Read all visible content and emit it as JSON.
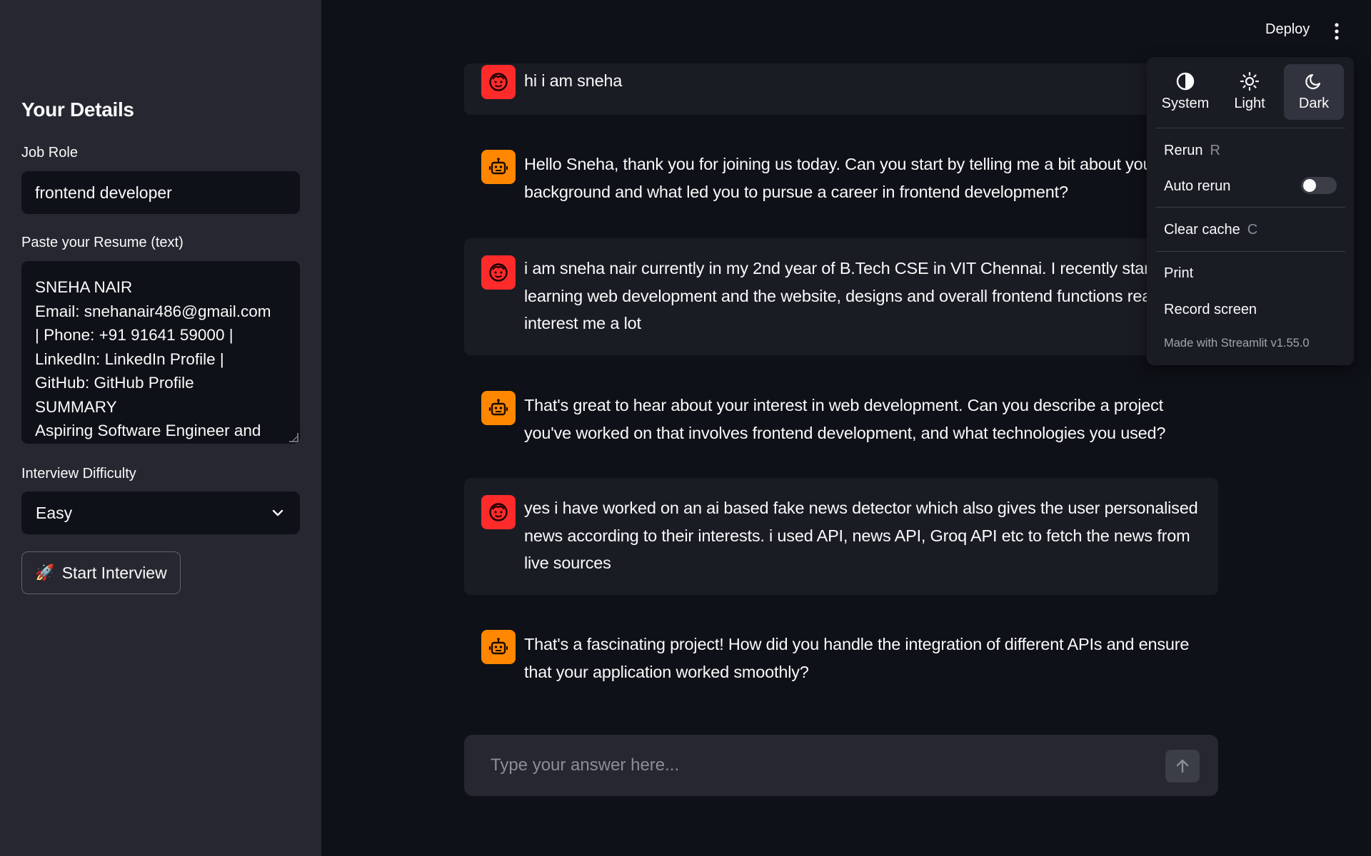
{
  "sidebar": {
    "title": "Your Details",
    "job_role": {
      "label": "Job Role",
      "value": "frontend developer"
    },
    "resume": {
      "label": "Paste your Resume (text)",
      "lines": [
        "SNEHA NAIR",
        "Email: snehanair486@gmail.com",
        "| Phone: +91 91641 59000 |",
        "LinkedIn: LinkedIn Profile |",
        "GitHub: GitHub Profile",
        "SUMMARY",
        "Aspiring Software Engineer and"
      ]
    },
    "difficulty": {
      "label": "Interview Difficulty",
      "value": "Easy"
    },
    "start_button": "Start Interview"
  },
  "toolbar": {
    "deploy_label": "Deploy"
  },
  "chat": {
    "messages": [
      {
        "role": "user",
        "text": "hi i am sneha"
      },
      {
        "role": "assistant",
        "text": "Hello Sneha, thank you for joining us today. Can you start by telling me a bit about your background and what led you to pursue a career in frontend development?"
      },
      {
        "role": "user",
        "text": "i am sneha nair currently in my 2nd year of B.Tech CSE in VIT Chennai. I recently started learning web development and the website, designs and overall frontend functions really interest me a lot"
      },
      {
        "role": "assistant",
        "text": "That's great to hear about your interest in web development. Can you describe a project you've worked on that involves frontend development, and what technologies you used?"
      },
      {
        "role": "user",
        "text": "yes i have worked on an ai based fake news detector which also gives the user personalised news according to their interests. i used API, news API, Groq API etc to fetch the news from live sources"
      },
      {
        "role": "assistant",
        "text": "That's a fascinating project! How did you handle the integration of different APIs and ensure that your application worked smoothly?"
      }
    ],
    "input_placeholder": "Type your answer here..."
  },
  "menu": {
    "themes": [
      {
        "label": "System",
        "icon": "contrast-icon"
      },
      {
        "label": "Light",
        "icon": "sun-icon"
      },
      {
        "label": "Dark",
        "icon": "moon-icon",
        "active": true
      }
    ],
    "rerun": {
      "label": "Rerun",
      "shortcut": "R"
    },
    "auto_rerun": {
      "label": "Auto rerun",
      "enabled": false
    },
    "clear_cache": {
      "label": "Clear cache",
      "shortcut": "C"
    },
    "print": "Print",
    "record_screen": "Record screen",
    "made_with": "Made with Streamlit v1.55.0"
  },
  "colors": {
    "background": "#0e1117",
    "sidebar": "#262730",
    "user_avatar": "#ff2b2b",
    "assistant_avatar": "#ff8700"
  }
}
